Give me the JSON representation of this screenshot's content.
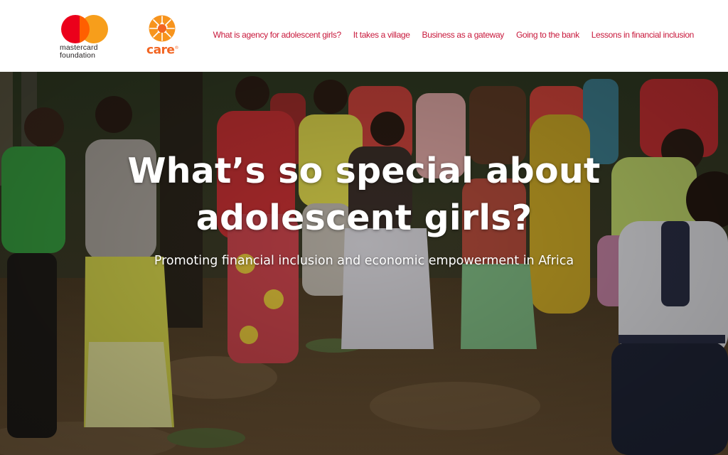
{
  "header": {
    "mastercard_logo": {
      "line1": "mastercard",
      "line2": "foundation",
      "colors": {
        "red": "#eb001b",
        "yellow": "#f79e1b",
        "overlap": "#ff5f00"
      }
    },
    "care_logo": {
      "word": "care",
      "mark": "®",
      "color": "#f26522"
    },
    "nav": [
      {
        "label": "What is agency for adolescent girls?"
      },
      {
        "label": "It takes a village"
      },
      {
        "label": "Business as a gateway"
      },
      {
        "label": "Going to the bank"
      },
      {
        "label": "Lessons in financial inclusion"
      }
    ],
    "nav_color": "#c8193c"
  },
  "hero": {
    "title_line1": "What’s so special about",
    "title_line2": "adolescent girls?",
    "subtitle": "Promoting financial inclusion and economic empowerment in Africa",
    "background_icon": "photo-group-of-girls-dancing"
  }
}
